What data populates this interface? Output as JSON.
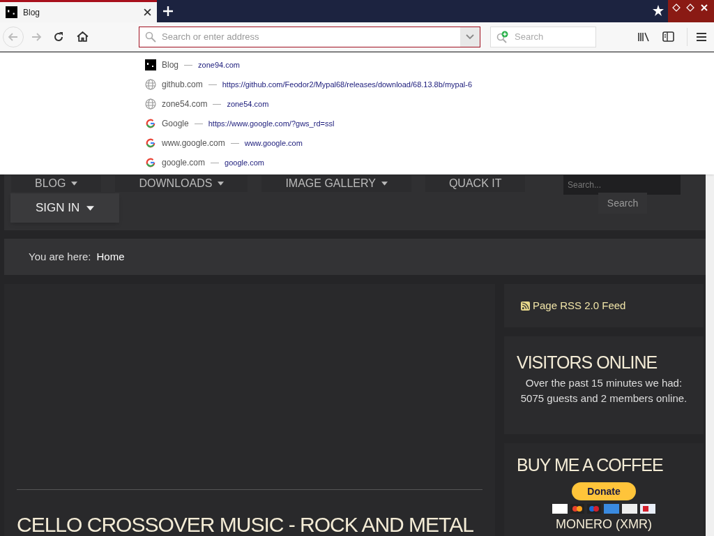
{
  "tabs": [
    {
      "title": "Blog",
      "selected": true
    }
  ],
  "toolbar": {
    "address_placeholder": "Search or enter address",
    "search_placeholder": "Search"
  },
  "suggestions": [
    {
      "kind": "site",
      "title": "Blog",
      "url": "zone94.com"
    },
    {
      "kind": "globe",
      "title": "github.com",
      "url": "https://github.com/Feodor2/Mypal68/releases/download/68.13.8b/mypal-6"
    },
    {
      "kind": "globe",
      "title": "zone54.com",
      "url": "zone54.com"
    },
    {
      "kind": "google",
      "title": "Google",
      "url": "https://www.google.com/?gws_rd=ssl"
    },
    {
      "kind": "google",
      "title": "www.google.com",
      "url": "www.google.com"
    },
    {
      "kind": "google",
      "title": "google.com",
      "url": "google.com"
    }
  ],
  "site": {
    "menu": [
      {
        "label": "BLOG",
        "caret": true
      },
      {
        "label": "DOWNLOADS",
        "caret": true
      },
      {
        "label": "IMAGE GALLERY",
        "caret": true
      },
      {
        "label": "QUACK IT",
        "caret": false
      }
    ],
    "sign_in": "SIGN IN",
    "search_placeholder": "Search...",
    "search_button": "Search",
    "breadcrumb_label": "You are here:",
    "breadcrumb": "Home",
    "article_title": "CELLO CROSSOVER MUSIC - ROCK AND METAL",
    "rss": "Page RSS 2.0 Feed",
    "visitors_title": "VISITORS ONLINE",
    "visitors_text": "Over the past 15 minutes we had: 5075 guests and 2 members online.",
    "coffee_title": "BUY ME A COFFEE",
    "donate": "Donate",
    "monero_title": "MONERO (XMR)"
  }
}
